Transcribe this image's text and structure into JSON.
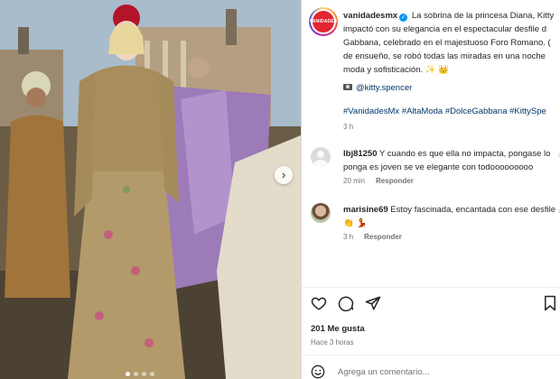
{
  "post": {
    "username": "vanidadesmx",
    "brand_logo_text": "VANIDADES",
    "caption_lines": [
      "La sobrina de la princesa Diana, Kitty",
      "impactó con su elegancia en el espectacular desfile d",
      "Gabbana, celebrado en el majestuoso Foro Romano. (",
      "de ensueño, se robó todas las miradas en una noche",
      "moda y sofisticación. ✨ 👑"
    ],
    "photo_credit_icon": "camera-icon",
    "photo_credit": "@kitty.spencer",
    "hashtags": "#VanidadesMx #AltaModa #DolceGabbana #KittySpe",
    "time": "3 h"
  },
  "comments": [
    {
      "username": "lbj81250",
      "lines": [
        "Y cuando es que ella no impacta, pongase lo",
        "ponga es joven se ve elegante con todooooooooo"
      ],
      "time": "20 min",
      "reply_label": "Responder"
    },
    {
      "username": "marisine69",
      "lines": [
        "Estoy fascinada, encantada con ese desfile",
        "👏 💃"
      ],
      "time": "3 h",
      "reply_label": "Responder"
    }
  ],
  "actions": {
    "icons": [
      "heart-icon",
      "comment-icon",
      "share-icon",
      "bookmark-icon"
    ]
  },
  "likes": "201 Me gusta",
  "posted_ago": "Hace 3 horas",
  "add_comment": {
    "placeholder": "Agrega un comentario..."
  },
  "carousel": {
    "next": "›"
  },
  "colors": {
    "link": "#00376b",
    "verified": "#0095f6",
    "muted": "#737373",
    "divider": "#dbdbdb"
  }
}
